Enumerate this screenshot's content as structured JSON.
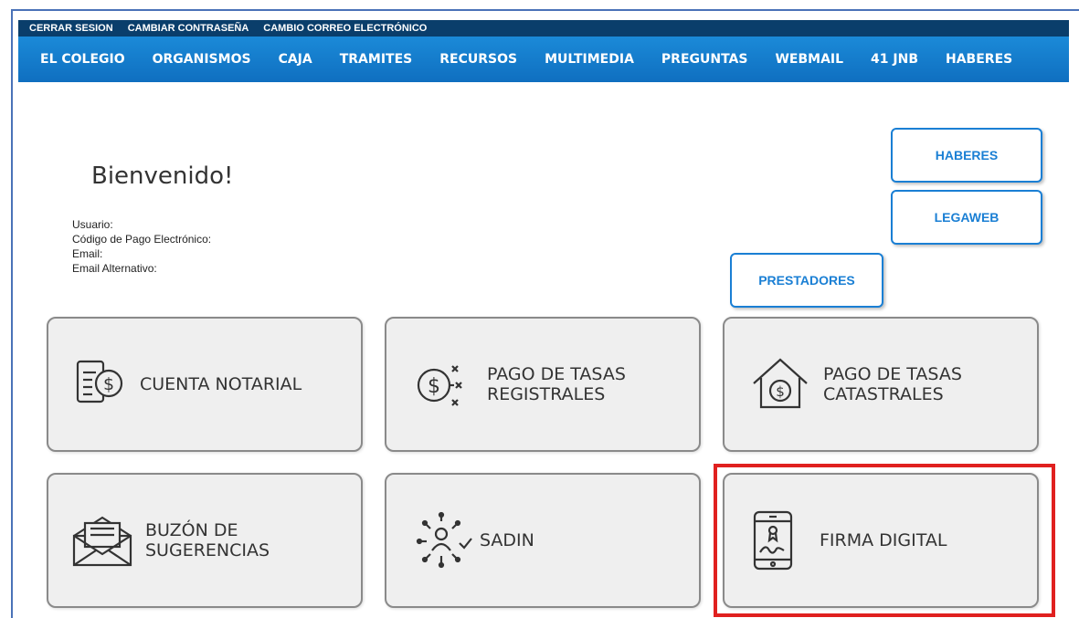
{
  "topbar": {
    "items": [
      "CERRAR SESION",
      "CAMBIAR CONTRASEÑA",
      "CAMBIO CORREO ELECTRÓNICO"
    ]
  },
  "nav": {
    "items": [
      "EL COLEGIO",
      "ORGANISMOS",
      "CAJA",
      "TRAMITES",
      "RECURSOS",
      "MULTIMEDIA",
      "PREGUNTAS",
      "WEBMAIL",
      "41 JNB",
      "HABERES"
    ]
  },
  "welcome": {
    "title": "Bienvenido!",
    "usuario": "Usuario:",
    "codigo": "Código de Pago Electrónico:",
    "email": "Email:",
    "email_alt": "Email Alternativo:"
  },
  "buttons": {
    "haberes": "HABERES",
    "legaweb": "LEGAWEB",
    "prestadores": "PRESTADORES"
  },
  "tiles": {
    "cuenta_notarial": "CUENTA NOTARIAL",
    "tasas_registrales_1": "PAGO DE TASAS",
    "tasas_registrales_2": "REGISTRALES",
    "tasas_catastrales_1": "PAGO DE TASAS",
    "tasas_catastrales_2": "CATASTRALES",
    "buzon_1": "BUZÓN DE",
    "buzon_2": "SUGERENCIAS",
    "sadin": "SADIN",
    "firma_digital": "FIRMA DIGITAL"
  },
  "colors": {
    "nav_blue": "#1a7fd4",
    "dark_bar": "#0a3e6b",
    "highlight": "#e0201f"
  }
}
